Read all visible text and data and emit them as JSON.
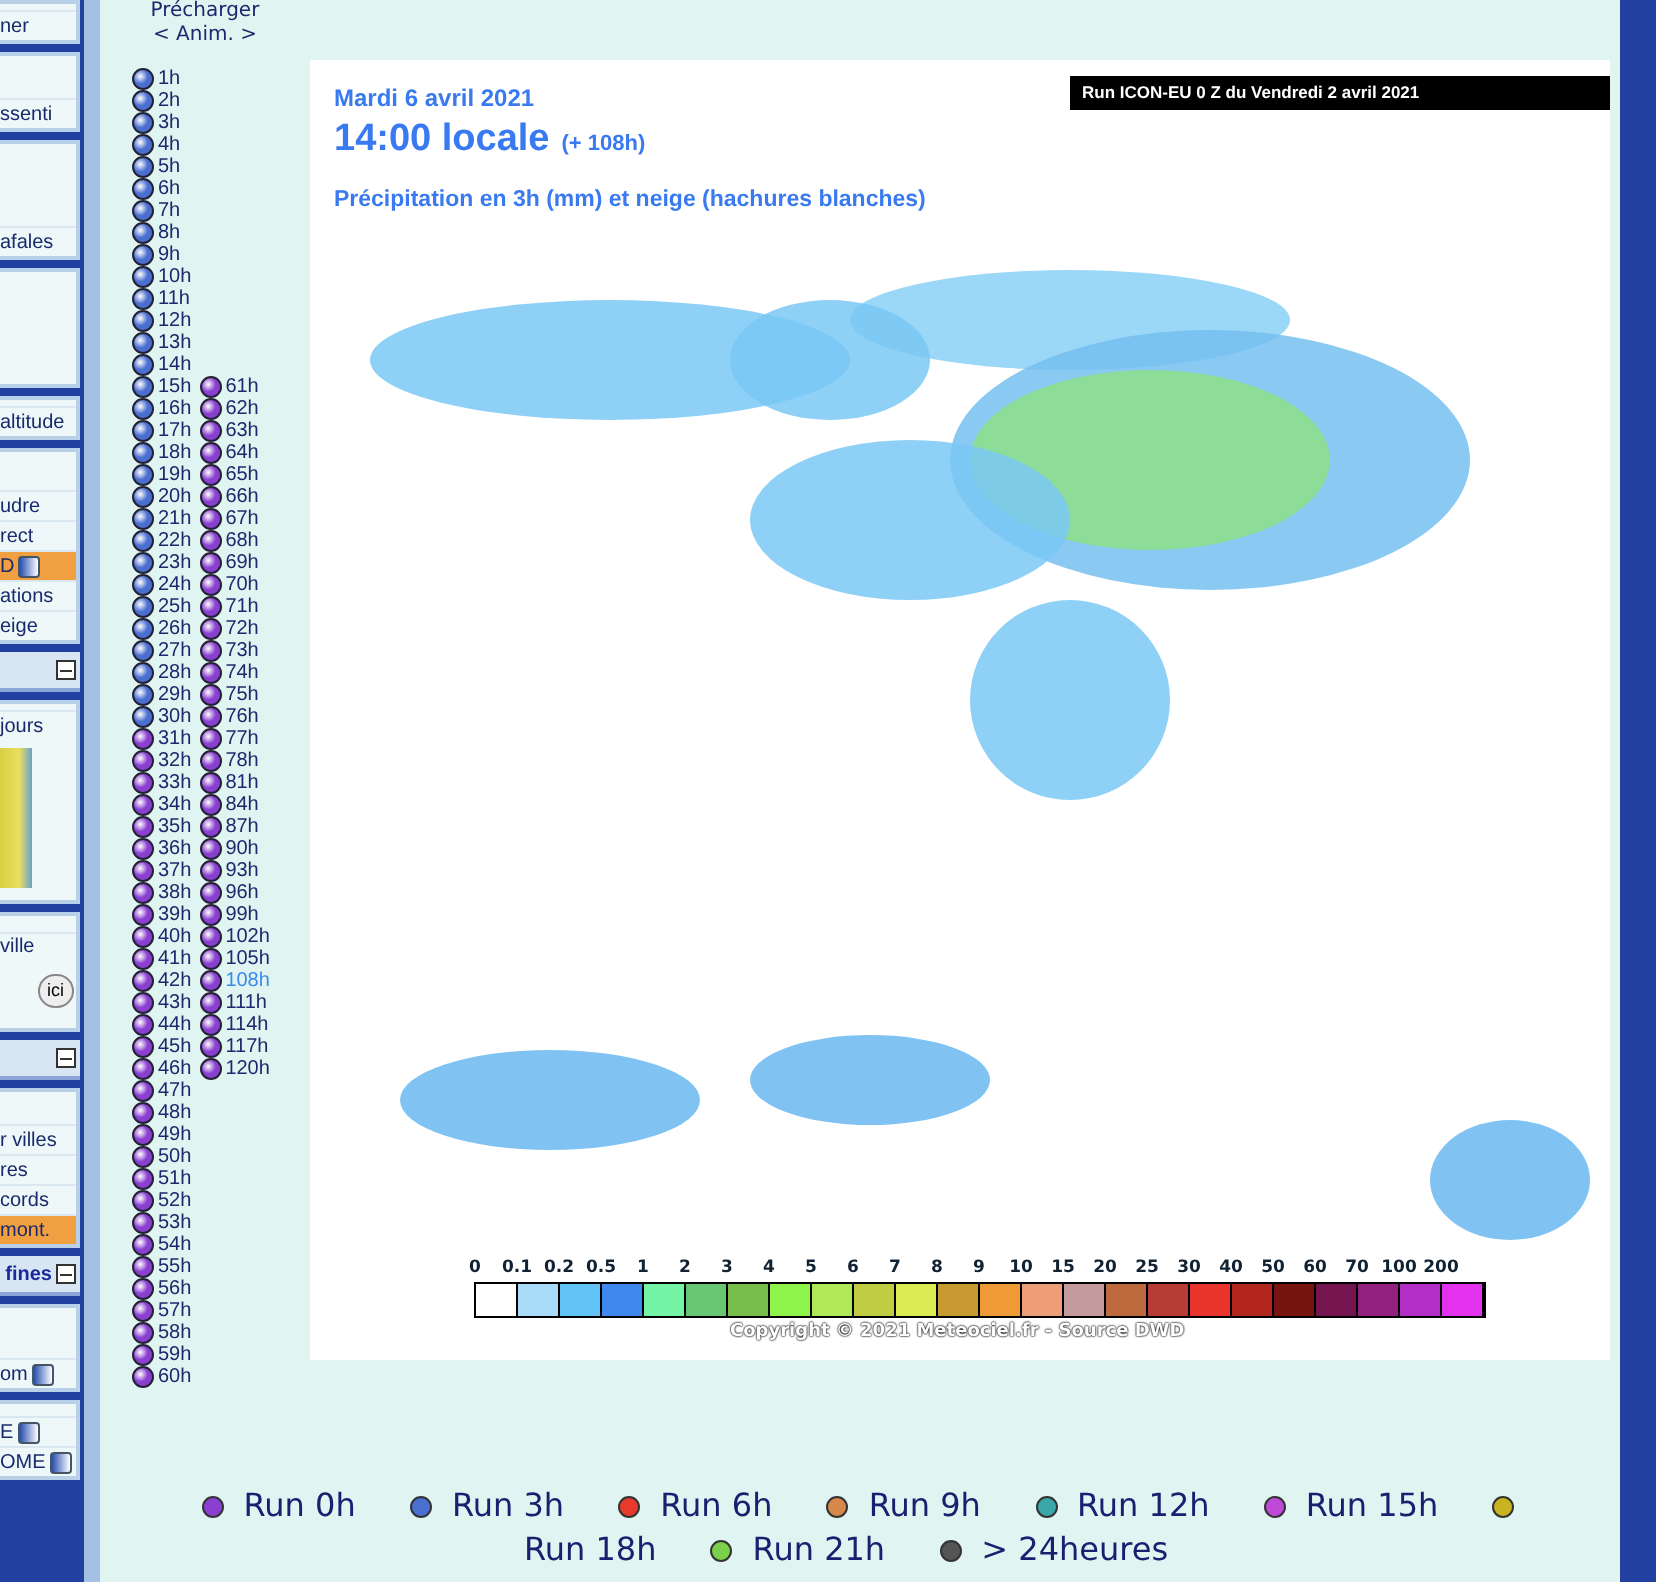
{
  "sidebar": [
    {
      "kind": "panel",
      "items": [
        {
          "label": "ner",
          "selected": false,
          "icon": false
        }
      ]
    },
    {
      "kind": "panel",
      "items": [
        {
          "label": "ssenti",
          "selected": false,
          "icon": false
        }
      ]
    },
    {
      "kind": "panel",
      "items": [
        {
          "label": "afales",
          "selected": false,
          "icon": false
        }
      ]
    },
    {
      "kind": "panel"
    },
    {
      "kind": "panel",
      "items": [
        {
          "label": "altitude",
          "selected": false,
          "icon": false
        }
      ]
    },
    {
      "kind": "panel",
      "items": [
        {
          "label": "udre",
          "selected": false,
          "icon": false
        },
        {
          "label": "rect",
          "selected": false,
          "icon": false
        },
        {
          "label": "D",
          "selected": true,
          "icon": true
        },
        {
          "label": "ations",
          "selected": false,
          "icon": false
        },
        {
          "label": "eige",
          "selected": false,
          "icon": false
        }
      ]
    },
    {
      "kind": "header"
    },
    {
      "kind": "panel",
      "items": [
        {
          "label": "jours",
          "selected": false,
          "icon": false
        }
      ],
      "thumbnail": true
    },
    {
      "kind": "panel",
      "items": [
        {
          "label": "ville",
          "selected": false,
          "icon": false
        }
      ],
      "buttons": [
        "ici"
      ]
    },
    {
      "kind": "header"
    },
    {
      "kind": "panel",
      "items": [
        {
          "label": "r villes",
          "selected": false,
          "icon": false
        },
        {
          "label": "res",
          "selected": false,
          "icon": false
        },
        {
          "label": "cords",
          "selected": false,
          "icon": false
        },
        {
          "label": "mont.",
          "selected": true,
          "icon": false
        }
      ]
    },
    {
      "kind": "header",
      "label": "fines"
    },
    {
      "kind": "panel",
      "items": [
        {
          "label": "om",
          "selected": false,
          "icon": true
        }
      ]
    },
    {
      "kind": "panel",
      "items": [
        {
          "label": "E",
          "selected": false,
          "icon": true
        },
        {
          "label": "OME",
          "selected": false,
          "icon": true
        }
      ]
    }
  ],
  "preload": {
    "title": "Précharger",
    "anim": "< Anim. >"
  },
  "hours": [
    [
      {
        "label": "1h",
        "selected": false,
        "color": "#4a6fd0"
      },
      {
        "label": "2h",
        "selected": false,
        "color": "#4a6fd0"
      },
      {
        "label": "3h",
        "selected": false,
        "color": "#4a6fd0"
      },
      {
        "label": "4h",
        "selected": false,
        "color": "#4a6fd0"
      },
      {
        "label": "5h",
        "selected": false,
        "color": "#4a6fd0"
      },
      {
        "label": "6h",
        "selected": false,
        "color": "#4a6fd0"
      },
      {
        "label": "7h",
        "selected": false,
        "color": "#4a6fd0"
      },
      {
        "label": "8h",
        "selected": false,
        "color": "#4a6fd0"
      },
      {
        "label": "9h",
        "selected": false,
        "color": "#4a6fd0"
      },
      {
        "label": "10h",
        "selected": false,
        "color": "#4a6fd0"
      },
      {
        "label": "11h",
        "selected": false,
        "color": "#4a6fd0"
      },
      {
        "label": "12h",
        "selected": false,
        "color": "#4a6fd0"
      },
      {
        "label": "13h",
        "selected": false,
        "color": "#4a6fd0"
      },
      {
        "label": "14h",
        "selected": false,
        "color": "#4a6fd0"
      },
      {
        "label": "15h",
        "selected": false,
        "color": "#4a6fd0"
      },
      {
        "label": "16h",
        "selected": false,
        "color": "#4a6fd0"
      },
      {
        "label": "17h",
        "selected": false,
        "color": "#4a6fd0"
      },
      {
        "label": "18h",
        "selected": false,
        "color": "#4a6fd0"
      },
      {
        "label": "19h",
        "selected": false,
        "color": "#4a6fd0"
      },
      {
        "label": "20h",
        "selected": false,
        "color": "#4a6fd0"
      },
      {
        "label": "21h",
        "selected": false,
        "color": "#4a6fd0"
      },
      {
        "label": "22h",
        "selected": false,
        "color": "#4a6fd0"
      },
      {
        "label": "23h",
        "selected": false,
        "color": "#4a6fd0"
      },
      {
        "label": "24h",
        "selected": false,
        "color": "#4a6fd0"
      },
      {
        "label": "25h",
        "selected": false,
        "color": "#4a6fd0"
      },
      {
        "label": "26h",
        "selected": false,
        "color": "#4a6fd0"
      },
      {
        "label": "27h",
        "selected": false,
        "color": "#4a6fd0"
      },
      {
        "label": "28h",
        "selected": false,
        "color": "#4a6fd0"
      },
      {
        "label": "29h",
        "selected": false,
        "color": "#4a6fd0"
      },
      {
        "label": "30h",
        "selected": false,
        "color": "#4a6fd0"
      },
      {
        "label": "31h",
        "selected": false,
        "color": "#8a3fd0"
      },
      {
        "label": "32h",
        "selected": false,
        "color": "#8a3fd0"
      },
      {
        "label": "33h",
        "selected": false,
        "color": "#8a3fd0"
      },
      {
        "label": "34h",
        "selected": false,
        "color": "#8a3fd0"
      },
      {
        "label": "35h",
        "selected": false,
        "color": "#8a3fd0"
      },
      {
        "label": "36h",
        "selected": false,
        "color": "#8a3fd0"
      },
      {
        "label": "37h",
        "selected": false,
        "color": "#8a3fd0"
      },
      {
        "label": "38h",
        "selected": false,
        "color": "#8a3fd0"
      },
      {
        "label": "39h",
        "selected": false,
        "color": "#8a3fd0"
      },
      {
        "label": "40h",
        "selected": false,
        "color": "#8a3fd0"
      },
      {
        "label": "41h",
        "selected": false,
        "color": "#8a3fd0"
      },
      {
        "label": "42h",
        "selected": false,
        "color": "#8a3fd0"
      },
      {
        "label": "43h",
        "selected": false,
        "color": "#8a3fd0"
      },
      {
        "label": "44h",
        "selected": false,
        "color": "#8a3fd0"
      },
      {
        "label": "45h",
        "selected": false,
        "color": "#8a3fd0"
      },
      {
        "label": "46h",
        "selected": false,
        "color": "#8a3fd0"
      },
      {
        "label": "47h",
        "selected": false,
        "color": "#8a3fd0"
      },
      {
        "label": "48h",
        "selected": false,
        "color": "#8a3fd0"
      },
      {
        "label": "49h",
        "selected": false,
        "color": "#8a3fd0"
      },
      {
        "label": "50h",
        "selected": false,
        "color": "#8a3fd0"
      },
      {
        "label": "51h",
        "selected": false,
        "color": "#8a3fd0"
      },
      {
        "label": "52h",
        "selected": false,
        "color": "#8a3fd0"
      },
      {
        "label": "53h",
        "selected": false,
        "color": "#8a3fd0"
      },
      {
        "label": "54h",
        "selected": false,
        "color": "#8a3fd0"
      },
      {
        "label": "55h",
        "selected": false,
        "color": "#8a3fd0"
      },
      {
        "label": "56h",
        "selected": false,
        "color": "#8a3fd0"
      },
      {
        "label": "57h",
        "selected": false,
        "color": "#8a3fd0"
      },
      {
        "label": "58h",
        "selected": false,
        "color": "#8a3fd0"
      },
      {
        "label": "59h",
        "selected": false,
        "color": "#8a3fd0"
      },
      {
        "label": "60h",
        "selected": false,
        "color": "#8a3fd0"
      }
    ],
    [
      {
        "label": "61h",
        "selected": false,
        "color": "#8a3fd0"
      },
      {
        "label": "62h",
        "selected": false,
        "color": "#8a3fd0"
      },
      {
        "label": "63h",
        "selected": false,
        "color": "#8a3fd0"
      },
      {
        "label": "64h",
        "selected": false,
        "color": "#8a3fd0"
      },
      {
        "label": "65h",
        "selected": false,
        "color": "#8a3fd0"
      },
      {
        "label": "66h",
        "selected": false,
        "color": "#8a3fd0"
      },
      {
        "label": "67h",
        "selected": false,
        "color": "#8a3fd0"
      },
      {
        "label": "68h",
        "selected": false,
        "color": "#8a3fd0"
      },
      {
        "label": "69h",
        "selected": false,
        "color": "#8a3fd0"
      },
      {
        "label": "70h",
        "selected": false,
        "color": "#8a3fd0"
      },
      {
        "label": "71h",
        "selected": false,
        "color": "#8a3fd0"
      },
      {
        "label": "72h",
        "selected": false,
        "color": "#8a3fd0"
      },
      {
        "label": "73h",
        "selected": false,
        "color": "#8a3fd0"
      },
      {
        "label": "74h",
        "selected": false,
        "color": "#8a3fd0"
      },
      {
        "label": "75h",
        "selected": false,
        "color": "#8a3fd0"
      },
      {
        "label": "76h",
        "selected": false,
        "color": "#8a3fd0"
      },
      {
        "label": "77h",
        "selected": false,
        "color": "#8a3fd0"
      },
      {
        "label": "78h",
        "selected": false,
        "color": "#8a3fd0"
      },
      {
        "label": "81h",
        "selected": false,
        "color": "#8a3fd0"
      },
      {
        "label": "84h",
        "selected": false,
        "color": "#8a3fd0"
      },
      {
        "label": "87h",
        "selected": false,
        "color": "#8a3fd0"
      },
      {
        "label": "90h",
        "selected": false,
        "color": "#8a3fd0"
      },
      {
        "label": "93h",
        "selected": false,
        "color": "#8a3fd0"
      },
      {
        "label": "96h",
        "selected": false,
        "color": "#8a3fd0"
      },
      {
        "label": "99h",
        "selected": false,
        "color": "#8a3fd0"
      },
      {
        "label": "102h",
        "selected": false,
        "color": "#8a3fd0"
      },
      {
        "label": "105h",
        "selected": false,
        "color": "#8a3fd0"
      },
      {
        "label": "108h",
        "selected": true,
        "color": "#8a3fd0"
      },
      {
        "label": "111h",
        "selected": false,
        "color": "#8a3fd0"
      },
      {
        "label": "114h",
        "selected": false,
        "color": "#8a3fd0"
      },
      {
        "label": "117h",
        "selected": false,
        "color": "#8a3fd0"
      },
      {
        "label": "120h",
        "selected": false,
        "color": "#8a3fd0"
      }
    ]
  ],
  "map": {
    "date": "Mardi 6 avril 2021",
    "time": "14:00 locale",
    "lead": "(+ 108h)",
    "subtitle": "Précipitation en 3h (mm) et neige (hachures blanches)",
    "run": "Run ICON-EU 0 Z du Vendredi 2 avril 2021",
    "copyright": "Copyright © 2021 Meteociel.fr - Source DWD",
    "legend": {
      "labels": [
        "0",
        "0.1",
        "0.2",
        "0.5",
        "1",
        "2",
        "3",
        "4",
        "5",
        "6",
        "7",
        "8",
        "9",
        "10",
        "15",
        "20",
        "25",
        "30",
        "40",
        "50",
        "60",
        "70",
        "100",
        "200"
      ],
      "swatches": [
        {
          "color": "#ffffff"
        },
        {
          "color": "#a8dcf8"
        },
        {
          "color": "#62c4f6"
        },
        {
          "color": "#4088ee"
        },
        {
          "color": "#74f4a4"
        },
        {
          "color": "#66c672"
        },
        {
          "color": "#78be4a"
        },
        {
          "color": "#8ef44a"
        },
        {
          "color": "#b0e858"
        },
        {
          "color": "#c0cc42"
        },
        {
          "color": "#dceb52"
        },
        {
          "color": "#c89a32"
        },
        {
          "color": "#ee9a36"
        },
        {
          "color": "#ee9e76"
        },
        {
          "color": "#c49a9c"
        },
        {
          "color": "#bc6a3e"
        },
        {
          "color": "#b83c36"
        },
        {
          "color": "#e8342a"
        },
        {
          "color": "#b2261e"
        },
        {
          "color": "#761410"
        },
        {
          "color": "#761450"
        },
        {
          "color": "#92207e"
        },
        {
          "color": "#b22ec6"
        },
        {
          "color": "#e232ee"
        }
      ]
    }
  },
  "runs": [
    {
      "label": "Run 0h",
      "color": "#8a3fd0"
    },
    {
      "label": "Run 3h",
      "color": "#4a6fd0"
    },
    {
      "label": "Run 6h",
      "color": "#e83a2a"
    },
    {
      "label": "Run 9h",
      "color": "#d8884a"
    },
    {
      "label": "Run 12h",
      "color": "#3aa8a8"
    },
    {
      "label": "Run 15h",
      "color": "#c04ad8"
    },
    {
      "label": "Run 18h",
      "color": "#c8b420"
    },
    {
      "label": "Run 21h",
      "color": "#7ad048"
    },
    {
      "label": "> 24heures",
      "color": "#555555"
    }
  ]
}
